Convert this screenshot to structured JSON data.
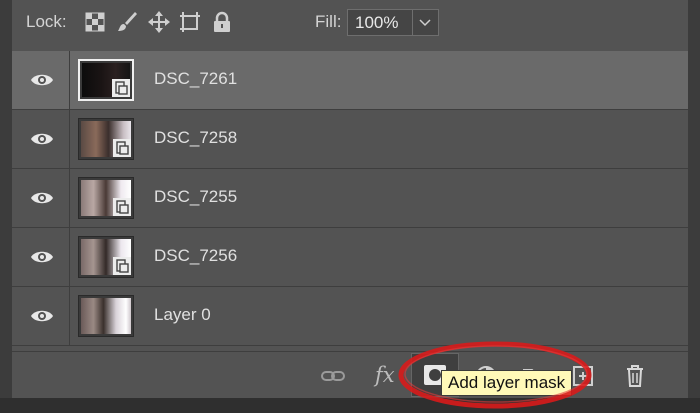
{
  "toolbar": {
    "lock_label": "Lock:",
    "fill_label": "Fill:",
    "fill_value": "100%",
    "lock_icons": [
      "lock-transparent-pixels-icon",
      "lock-image-pixels-icon",
      "lock-position-icon",
      "lock-artboard-icon",
      "lock-all-icon"
    ]
  },
  "layers": [
    {
      "name": "DSC_7261",
      "selected": true
    },
    {
      "name": "DSC_7258",
      "selected": false
    },
    {
      "name": "DSC_7255",
      "selected": false
    },
    {
      "name": "DSC_7256",
      "selected": false
    },
    {
      "name": "Layer 0",
      "selected": false
    }
  ],
  "bottom": {
    "fx_label": "fx",
    "tooltip": "Add layer mask"
  },
  "colors": {
    "panel": "#535353",
    "selected_row": "#6a6a6a",
    "tooltip_bg": "#fff9b8",
    "annotation": "#d81b1b"
  }
}
